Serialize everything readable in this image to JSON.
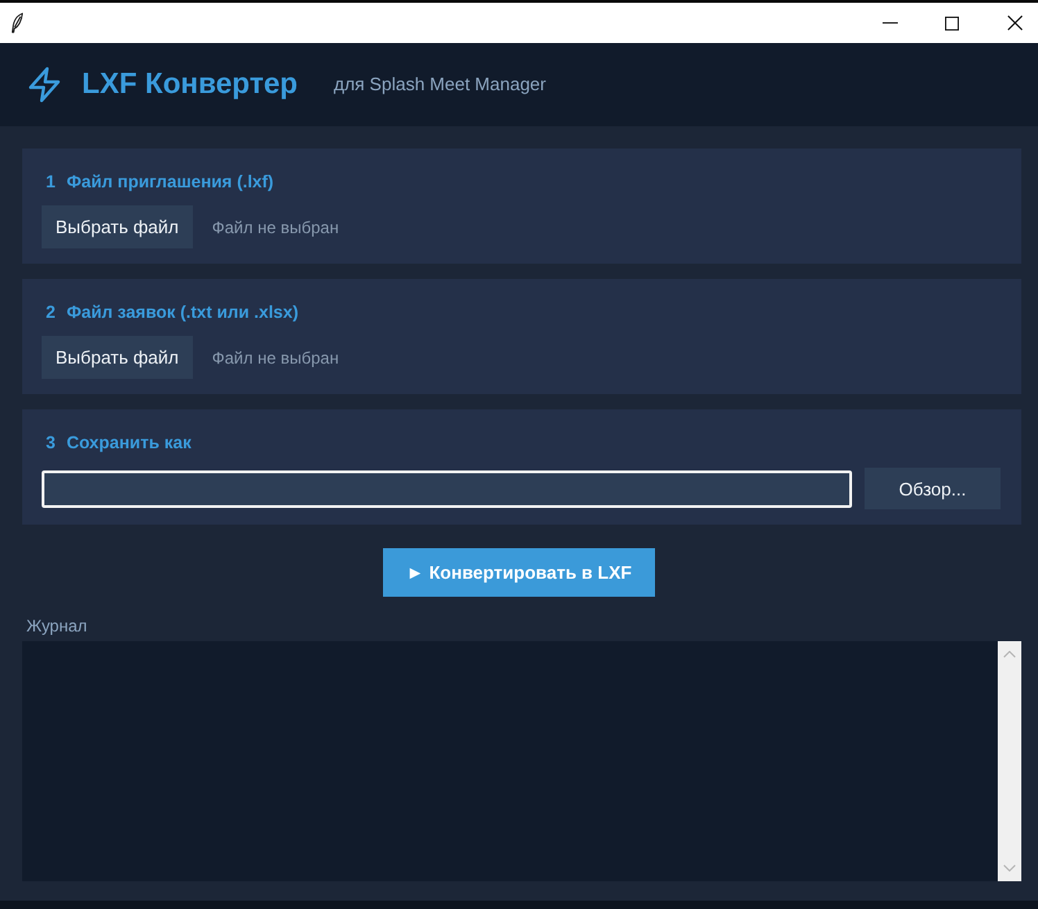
{
  "header": {
    "title": "LXF Конвертер",
    "subtitle": "для Splash Meet Manager"
  },
  "sections": [
    {
      "kind": "file",
      "number": "1",
      "label": "Файл приглашения (.lxf)",
      "button": "Выбрать файл",
      "status": "Файл не выбран"
    },
    {
      "kind": "file",
      "number": "2",
      "label": "Файл заявок (.txt или .xlsx)",
      "button": "Выбрать файл",
      "status": "Файл не выбран"
    },
    {
      "kind": "save",
      "number": "3",
      "label": "Сохранить как",
      "focused": true,
      "button": "Обзор..."
    }
  ],
  "convert_button": {
    "label": "► Конвертировать в LXF"
  },
  "log": {
    "label": "Журнал"
  }
}
